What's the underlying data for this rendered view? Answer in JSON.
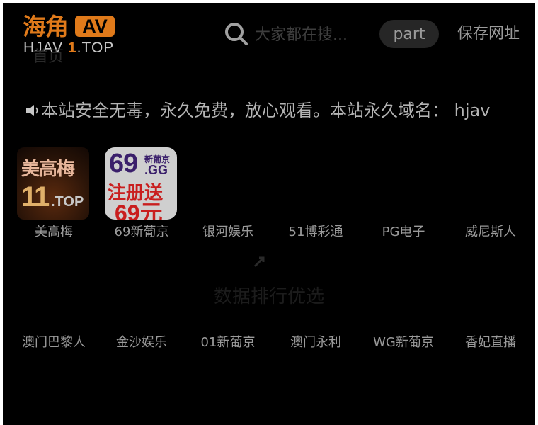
{
  "header": {
    "logo": {
      "cn": "海角",
      "badge": "AV",
      "domain_prefix": "HJAV ",
      "domain_num": "1",
      "domain_suffix": ".TOP"
    },
    "ghost_title": "首页",
    "search": {
      "placeholder": "大家都在搜..."
    },
    "part_label": "part",
    "save_link": "保存网址"
  },
  "notice": {
    "text": "本站安全无毒，永久免费，放心观看。本站永久域名： hjav"
  },
  "ads_row1": [
    {
      "label": "美高梅"
    },
    {
      "label": "69新葡京"
    },
    {
      "label": "银河娱乐"
    },
    {
      "label": "51博彩通"
    },
    {
      "label": "PG电子"
    },
    {
      "label": "威尼斯人"
    }
  ],
  "ad_images": {
    "meigaomei": {
      "cn": "美高梅",
      "num": "11",
      "top": ".TOP"
    },
    "g69": {
      "num": "69",
      "small": "新葡京",
      "gg": ".GG",
      "zhu": "注册送",
      "yuan": "69元"
    }
  },
  "section_heading": "数据排行优选",
  "ads_row2": [
    {
      "label": "澳门巴黎人"
    },
    {
      "label": "金沙娱乐"
    },
    {
      "label": "01新葡京"
    },
    {
      "label": "澳门永利"
    },
    {
      "label": "WG新葡京"
    },
    {
      "label": "香妃直播"
    }
  ],
  "colors": {
    "accent": "#e07a1a",
    "background": "#000000",
    "text": "#9a9a9a"
  }
}
